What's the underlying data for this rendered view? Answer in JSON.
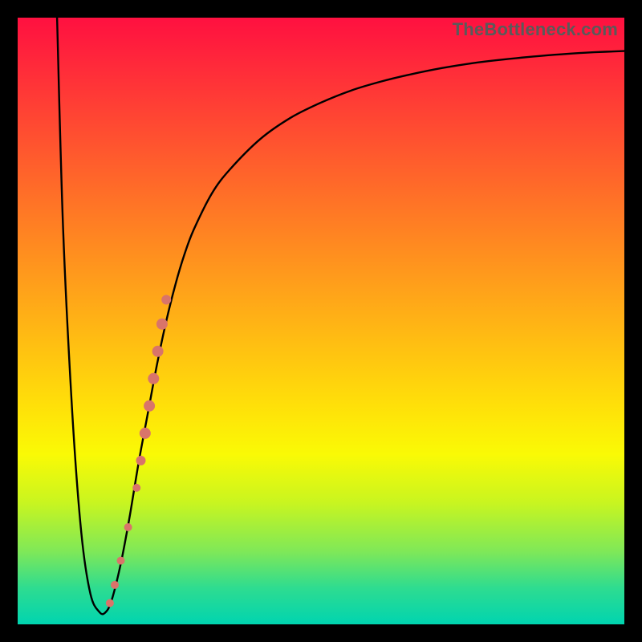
{
  "watermark": "TheBottleneck.com",
  "chart_data": {
    "type": "line",
    "title": "",
    "xlabel": "",
    "ylabel": "",
    "xlim": [
      0,
      100
    ],
    "ylim": [
      0,
      100
    ],
    "grid": false,
    "curve": {
      "comment": "Percentage coordinates of the black curve in plot-area space (0,0 top-left to 100,100 bottom-right)",
      "x": [
        6.5,
        7.5,
        9,
        10.5,
        12,
        13.5,
        14.5,
        15.5,
        17,
        18.5,
        20,
        21.5,
        23,
        24.5,
        26,
        27.5,
        29,
        32,
        35,
        40,
        45,
        50,
        55,
        60,
        65,
        70,
        75,
        80,
        85,
        90,
        95,
        100
      ],
      "y": [
        0,
        35,
        65,
        85,
        95,
        98,
        98,
        96,
        90,
        82,
        73,
        65,
        57,
        50,
        44,
        39,
        35,
        29,
        25,
        20,
        16.5,
        14,
        12,
        10.5,
        9.3,
        8.3,
        7.5,
        6.9,
        6.4,
        6.0,
        5.7,
        5.5
      ]
    },
    "markers": {
      "comment": "Salmon dot markers along rising branch; pct coords",
      "color": "#d9746a",
      "points": [
        {
          "x": 15.2,
          "y": 96.5,
          "r": 5
        },
        {
          "x": 16.0,
          "y": 93.5,
          "r": 5
        },
        {
          "x": 17.0,
          "y": 89.5,
          "r": 5
        },
        {
          "x": 18.2,
          "y": 84.0,
          "r": 5
        },
        {
          "x": 19.6,
          "y": 77.5,
          "r": 5
        },
        {
          "x": 20.3,
          "y": 73.0,
          "r": 6
        },
        {
          "x": 21.0,
          "y": 68.5,
          "r": 7
        },
        {
          "x": 21.7,
          "y": 64.0,
          "r": 7
        },
        {
          "x": 22.4,
          "y": 59.5,
          "r": 7
        },
        {
          "x": 23.1,
          "y": 55.0,
          "r": 7
        },
        {
          "x": 23.8,
          "y": 50.5,
          "r": 7
        },
        {
          "x": 24.5,
          "y": 46.5,
          "r": 6
        }
      ]
    }
  }
}
